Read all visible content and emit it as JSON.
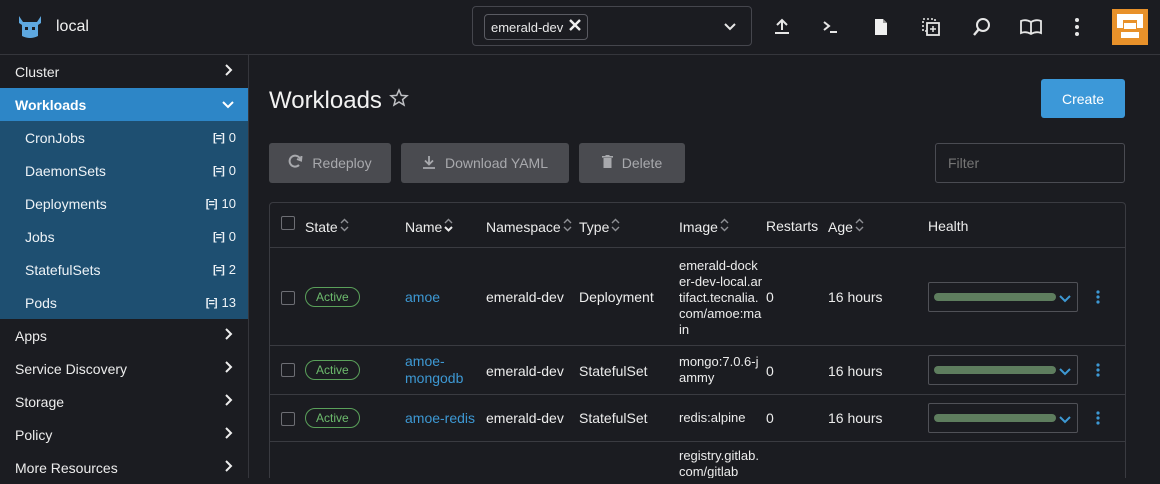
{
  "header": {
    "cluster_name": "local",
    "namespace_chip": "emerald-dev"
  },
  "sidebar": {
    "groups_top": [
      {
        "label": "Cluster"
      }
    ],
    "active_group": {
      "label": "Workloads"
    },
    "sub_items": [
      {
        "label": "CronJobs",
        "count": "0"
      },
      {
        "label": "DaemonSets",
        "count": "0"
      },
      {
        "label": "Deployments",
        "count": "10"
      },
      {
        "label": "Jobs",
        "count": "0"
      },
      {
        "label": "StatefulSets",
        "count": "2"
      },
      {
        "label": "Pods",
        "count": "13"
      }
    ],
    "groups_bottom": [
      {
        "label": "Apps"
      },
      {
        "label": "Service Discovery"
      },
      {
        "label": "Storage"
      },
      {
        "label": "Policy"
      },
      {
        "label": "More Resources"
      }
    ]
  },
  "main": {
    "title": "Workloads",
    "create_label": "Create",
    "actions": {
      "redeploy": "Redeploy",
      "download": "Download YAML",
      "delete": "Delete"
    },
    "filter_placeholder": "Filter"
  },
  "table": {
    "columns": {
      "state": "State",
      "name": "Name",
      "namespace": "Namespace",
      "type": "Type",
      "image": "Image",
      "restarts": "Restarts",
      "age": "Age",
      "health": "Health"
    },
    "rows": [
      {
        "state": "Active",
        "name": "amoe",
        "namespace": "emerald-dev",
        "type": "Deployment",
        "image": "emerald-docker-dev-local.artifact.tecnalia.com/amoe:main",
        "restarts": "0",
        "age": "16 hours"
      },
      {
        "state": "Active",
        "name": "amoe-mongodb",
        "namespace": "emerald-dev",
        "type": "StatefulSet",
        "image": "mongo:7.0.6-jammy",
        "restarts": "0",
        "age": "16 hours"
      },
      {
        "state": "Active",
        "name": "amoe-redis",
        "namespace": "emerald-dev",
        "type": "StatefulSet",
        "image": "redis:alpine",
        "restarts": "0",
        "age": "16 hours"
      },
      {
        "state": "",
        "name": "",
        "namespace": "",
        "type": "",
        "image": "registry.gitlab.com/gitlab",
        "restarts": "",
        "age": ""
      }
    ]
  },
  "colors": {
    "accent": "#3c98d8",
    "active_badge": "#6dbb6d",
    "health_bar": "#5e7d5e",
    "sidebar_active": "#2d86c7",
    "sidebar_sub": "#1e4f71"
  },
  "icons": [
    "cow-logo-icon",
    "close-icon",
    "chevron-down-icon",
    "upload-icon",
    "terminal-icon",
    "file-icon",
    "copy-icon",
    "search-icon",
    "book-icon",
    "kebab-icon",
    "chevron-right-icon",
    "star-icon",
    "refresh-icon",
    "download-icon",
    "trash-icon",
    "sort-icon"
  ]
}
